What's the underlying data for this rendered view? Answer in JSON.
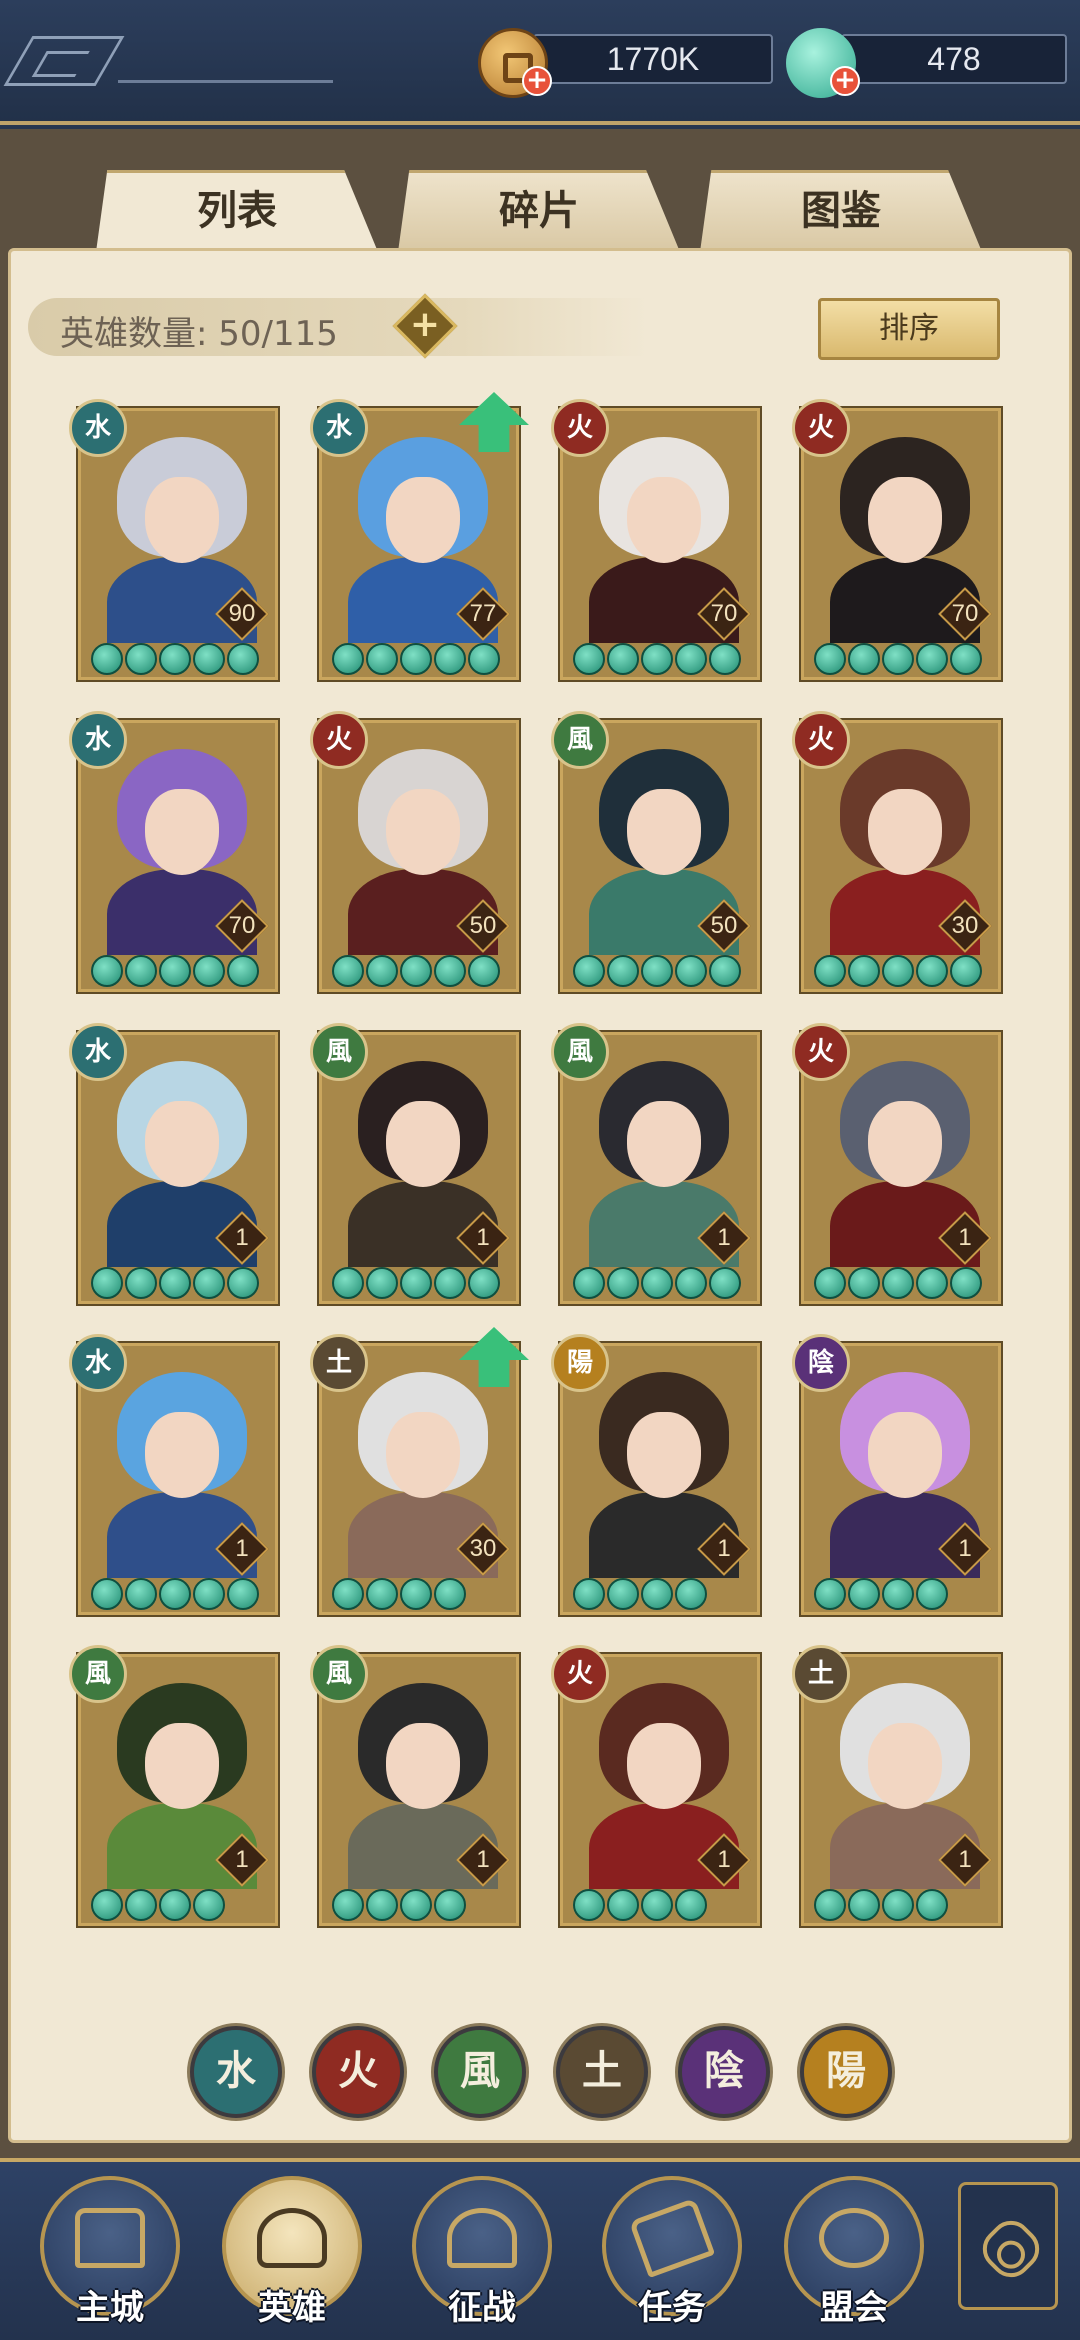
{
  "currencies": {
    "coins": {
      "value": "1770K",
      "icon": "copper-coin-icon"
    },
    "jade": {
      "value": "478",
      "icon": "jade-icon"
    }
  },
  "tabs": [
    {
      "label": "列表",
      "active": true
    },
    {
      "label": "碎片",
      "active": false
    },
    {
      "label": "图鉴",
      "active": false
    }
  ],
  "hero_count": {
    "label": "英雄数量: 50/115"
  },
  "sort_button": {
    "label": "排序"
  },
  "element_glyphs": {
    "water": "水",
    "fire": "火",
    "wind": "風",
    "earth": "土",
    "yin": "陰",
    "yang": "陽"
  },
  "heroes": [
    {
      "element": "water",
      "level": "90",
      "stars": 5,
      "upgrade": false
    },
    {
      "element": "water",
      "level": "77",
      "stars": 5,
      "upgrade": true
    },
    {
      "element": "fire",
      "level": "70",
      "stars": 5,
      "upgrade": false
    },
    {
      "element": "fire",
      "level": "70",
      "stars": 5,
      "upgrade": false
    },
    {
      "element": "water",
      "level": "70",
      "stars": 5,
      "upgrade": false
    },
    {
      "element": "fire",
      "level": "50",
      "stars": 5,
      "upgrade": false
    },
    {
      "element": "wind",
      "level": "50",
      "stars": 5,
      "upgrade": false
    },
    {
      "element": "fire",
      "level": "30",
      "stars": 5,
      "upgrade": false
    },
    {
      "element": "water",
      "level": "1",
      "stars": 5,
      "upgrade": false
    },
    {
      "element": "wind",
      "level": "1",
      "stars": 5,
      "upgrade": false
    },
    {
      "element": "wind",
      "level": "1",
      "stars": 5,
      "upgrade": false
    },
    {
      "element": "fire",
      "level": "1",
      "stars": 5,
      "upgrade": false
    },
    {
      "element": "water",
      "level": "1",
      "stars": 5,
      "upgrade": false
    },
    {
      "element": "earth",
      "level": "30",
      "stars": 4,
      "upgrade": true
    },
    {
      "element": "yang",
      "level": "1",
      "stars": 4,
      "upgrade": false
    },
    {
      "element": "yin",
      "level": "1",
      "stars": 4,
      "upgrade": false
    },
    {
      "element": "wind",
      "level": "1",
      "stars": 4,
      "upgrade": false
    },
    {
      "element": "wind",
      "level": "1",
      "stars": 4,
      "upgrade": false
    },
    {
      "element": "fire",
      "level": "1",
      "stars": 4,
      "upgrade": false
    },
    {
      "element": "earth",
      "level": "1",
      "stars": 4,
      "upgrade": false
    }
  ],
  "element_filters": [
    "water",
    "fire",
    "wind",
    "earth",
    "yin",
    "yang"
  ],
  "bottom_nav": [
    {
      "label": "主城",
      "icon": "city-gate-icon",
      "active": false
    },
    {
      "label": "英雄",
      "icon": "hero-portrait-icon",
      "active": true
    },
    {
      "label": "征战",
      "icon": "battle-helmet-icon",
      "active": false
    },
    {
      "label": "任务",
      "icon": "scroll-task-icon",
      "active": false
    },
    {
      "label": "盟会",
      "icon": "alliance-pavilion-icon",
      "active": false
    }
  ],
  "more_button": {
    "icon": "flower-menu-icon"
  },
  "colors": {
    "accent_gold": "#c7a865",
    "navy": "#27364f",
    "paper": "#f1e8d4"
  }
}
